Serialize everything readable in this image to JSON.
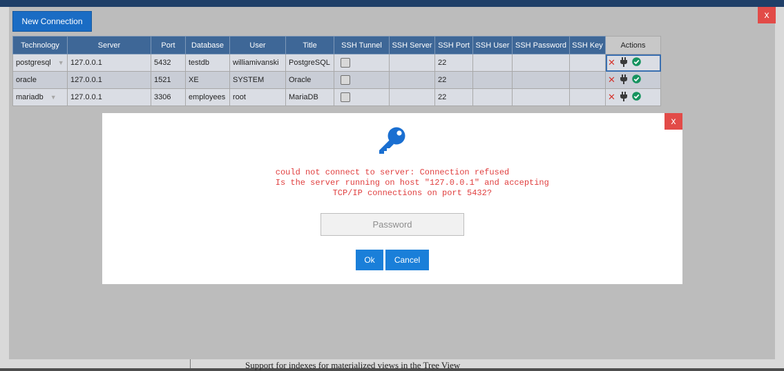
{
  "window": {
    "close_label": "x",
    "new_connection_label": "New Connection"
  },
  "table": {
    "headers": [
      "Technology",
      "Server",
      "Port",
      "Database",
      "User",
      "Title",
      "SSH Tunnel",
      "SSH Server",
      "SSH Port",
      "SSH User",
      "SSH Password",
      "SSH Key",
      "Actions"
    ],
    "rows": [
      {
        "technology": "postgresql",
        "server": "127.0.0.1",
        "port": "5432",
        "database": "testdb",
        "user": "williamivanski",
        "title": "PostgreSQL",
        "ssh_tunnel": false,
        "ssh_server": "",
        "ssh_port": "22",
        "ssh_user": "",
        "ssh_password": "",
        "ssh_key": "",
        "has_arrow": true
      },
      {
        "technology": "oracle",
        "server": "127.0.0.1",
        "port": "1521",
        "database": "XE",
        "user": "SYSTEM",
        "title": "Oracle",
        "ssh_tunnel": false,
        "ssh_server": "",
        "ssh_port": "22",
        "ssh_user": "",
        "ssh_password": "",
        "ssh_key": "",
        "has_arrow": false
      },
      {
        "technology": "mariadb",
        "server": "127.0.0.1",
        "port": "3306",
        "database": "employees",
        "user": "root",
        "title": "MariaDB",
        "ssh_tunnel": false,
        "ssh_server": "",
        "ssh_port": "22",
        "ssh_user": "",
        "ssh_password": "",
        "ssh_key": "",
        "has_arrow": true
      }
    ],
    "actions_icons": [
      "delete-icon",
      "plug-icon",
      "check-circle-icon"
    ]
  },
  "dialog": {
    "close_label": "x",
    "icon": "key-icon",
    "error_message": "could not connect to server: Connection refused\n\tIs the server running on host \"127.0.0.1\" and accepting\n\tTCP/IP connections on port 5432?",
    "password_placeholder": "Password",
    "ok_label": "Ok",
    "cancel_label": "Cancel"
  },
  "background": {
    "text": "Support for indexes for materialized views in the Tree View"
  },
  "colors": {
    "header_blue": "#3e6797",
    "button_blue": "#1a7fd9",
    "close_red": "#e24b48",
    "error_red": "#e03e3e",
    "key_blue": "#1a6fd1"
  }
}
